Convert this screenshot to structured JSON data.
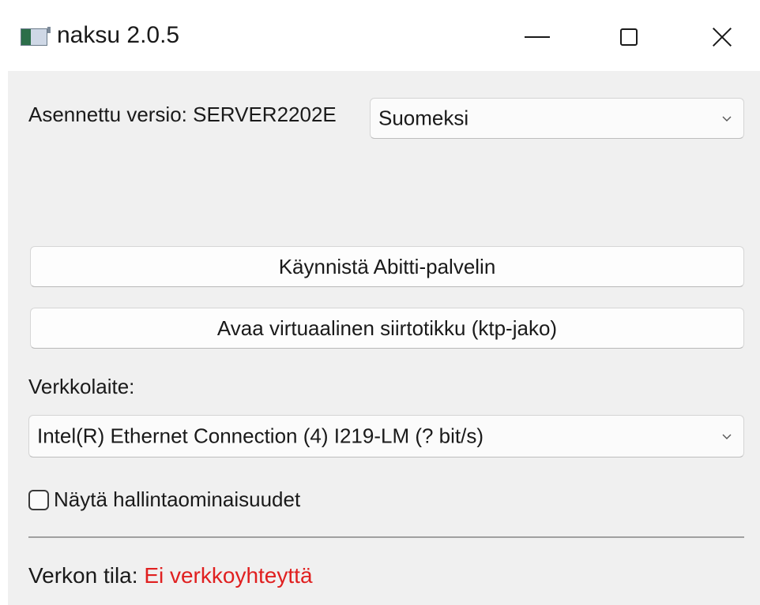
{
  "window": {
    "title": "naksu 2.0.5",
    "minimize_icon": "minimize-icon",
    "maximize_icon": "maximize-icon",
    "close_icon": "close-icon"
  },
  "version": {
    "label": "Asennettu versio: SERVER2202E"
  },
  "language": {
    "selected": "Suomeksi"
  },
  "buttons": {
    "start_server": "Käynnistä Abitti-palvelin",
    "open_usb": "Avaa virtuaalinen siirtotikku (ktp-jako)"
  },
  "network": {
    "label": "Verkkolaite:",
    "selected": "Intel(R) Ethernet Connection (4) I219-LM (? bit/s)"
  },
  "admin": {
    "checkbox_label": "Näytä hallintaominaisuudet",
    "checked": false
  },
  "status": {
    "label": "Verkon tila:",
    "value": "Ei verkkoyhteyttä",
    "value_color": "#e02020"
  }
}
